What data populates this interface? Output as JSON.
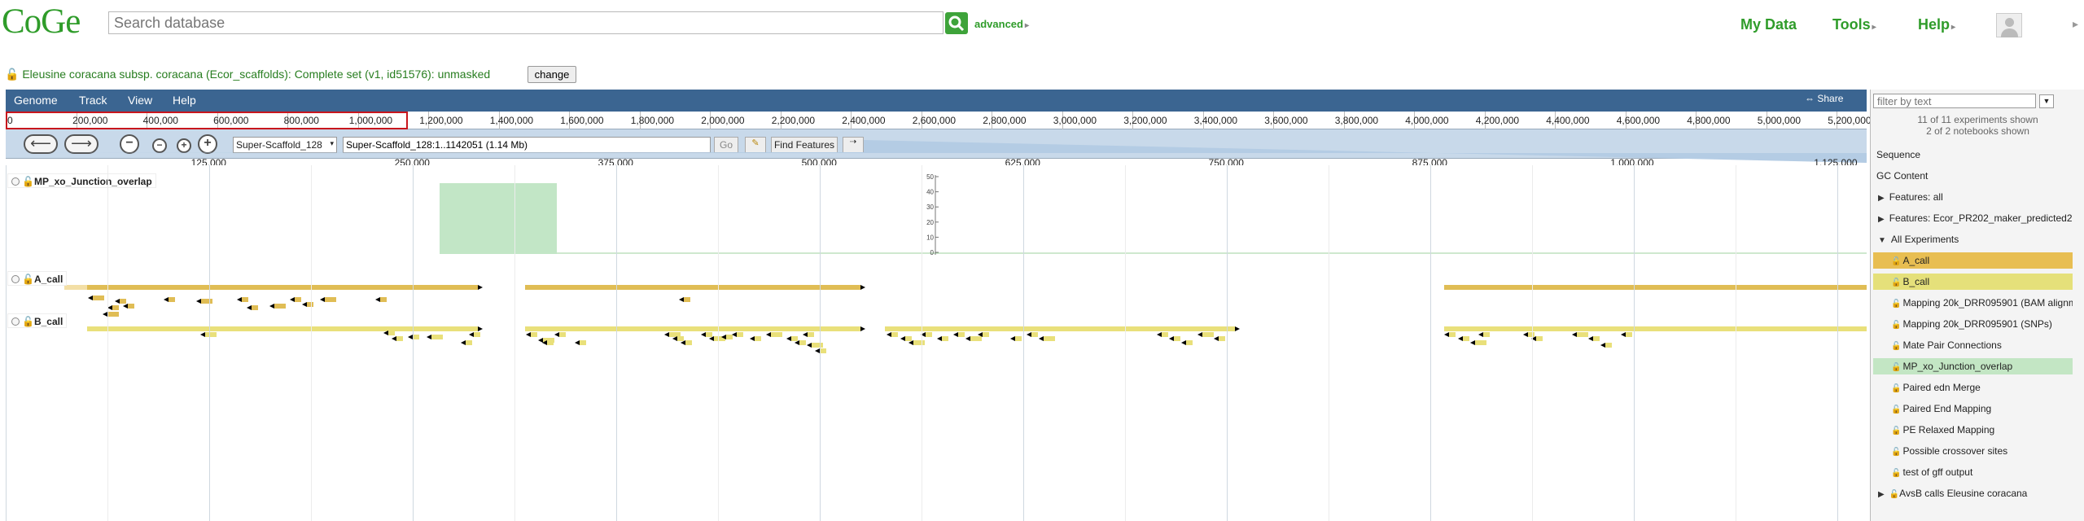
{
  "header": {
    "logo": "CoGe",
    "search_placeholder": "Search database",
    "advanced": "advanced",
    "nav": [
      "My Data",
      "Tools",
      "Help"
    ]
  },
  "genome_title": "Eleusine coracana subsp. coracana (Ecor_scaffolds): Complete set (v1, id51576): unmasked",
  "change_label": "change",
  "menu": [
    "Genome",
    "Track",
    "View",
    "Help"
  ],
  "share_label": "Share",
  "overview_ticks": [
    "0",
    "200,000",
    "400,000",
    "600,000",
    "800,000",
    "1,000,000",
    "1,200,000",
    "1,400,000",
    "1,600,000",
    "1,800,000",
    "2,000,000",
    "2,200,000",
    "2,400,000",
    "2,600,000",
    "2,800,000",
    "3,000,000",
    "3,200,000",
    "3,400,000",
    "3,600,000",
    "3,800,000",
    "4,000,000",
    "4,200,000",
    "4,400,000",
    "4,600,000",
    "4,800,000",
    "5,000,000",
    "5,200,000"
  ],
  "ref_select": "Super-Scaffold_128",
  "location": "Super-Scaffold_128:1..1142051 (1.14 Mb)",
  "go_label": "Go",
  "find_features": "Find Features",
  "scale_ticks": [
    "125,000",
    "250,000",
    "375,000",
    "500,000",
    "625,000",
    "750,000",
    "875,000",
    "1,000,000",
    "1,125,000"
  ],
  "tracks": [
    {
      "name": "MP_xo_Junction_overlap"
    },
    {
      "name": "A_call"
    },
    {
      "name": "B_call"
    }
  ],
  "histogram_axis": [
    "50",
    "40",
    "30",
    "20",
    "10",
    "0"
  ],
  "colors": {
    "a_call": "#e0bd55",
    "b_call": "#e9e07a",
    "junction": "#c2e6c6",
    "menubar": "#3b6591",
    "brand": "#2f9c2a"
  },
  "sidebar": {
    "filter_placeholder": "filter by text",
    "exp_count": "11 of 11 experiments shown",
    "nb_count": "2 of 2 notebooks shown",
    "items": [
      {
        "label": "Sequence",
        "type": "plain"
      },
      {
        "label": "GC Content",
        "type": "plain"
      },
      {
        "label": "Features: all",
        "type": "collapsed"
      },
      {
        "label": "Features: Ecor_PR202_maker_predicted2",
        "type": "collapsed"
      },
      {
        "label": "All Experiments",
        "type": "expanded"
      },
      {
        "label": "A_call",
        "type": "exp",
        "bg": "#e8be52"
      },
      {
        "label": "B_call",
        "type": "exp",
        "bg": "#e5e07a"
      },
      {
        "label": "Mapping 20k_DRR095901 (BAM alignm",
        "type": "exp"
      },
      {
        "label": "Mapping 20k_DRR095901 (SNPs)",
        "type": "exp"
      },
      {
        "label": "Mate Pair Connections",
        "type": "exp"
      },
      {
        "label": "MP_xo_Junction_overlap",
        "type": "exp",
        "bg": "#c3e6c4"
      },
      {
        "label": "Paired edn Merge",
        "type": "exp"
      },
      {
        "label": "Paired End Mapping",
        "type": "exp"
      },
      {
        "label": "PE Relaxed Mapping",
        "type": "exp"
      },
      {
        "label": "Possible crossover sites",
        "type": "exp"
      },
      {
        "label": "test of gff output",
        "type": "exp"
      },
      {
        "label": "AvsB calls Eleusine coracana",
        "type": "collapsed-lock"
      }
    ]
  }
}
